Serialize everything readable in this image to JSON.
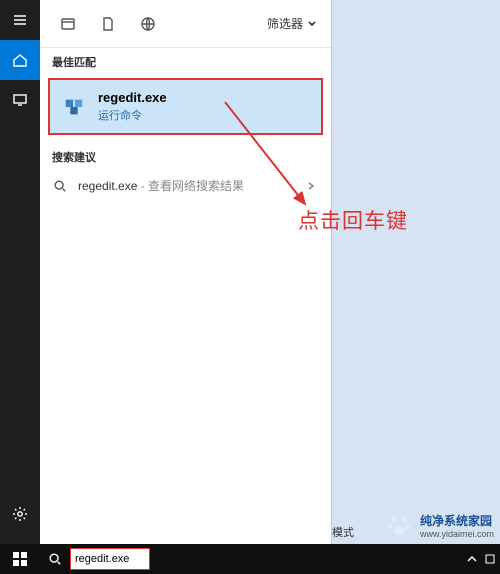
{
  "sidebar": {
    "items": [
      {
        "name": "menu"
      },
      {
        "name": "home"
      },
      {
        "name": "monitor"
      }
    ],
    "bottom": [
      {
        "name": "settings"
      },
      {
        "name": "user"
      }
    ]
  },
  "panel": {
    "filter_label": "筛选器",
    "best_match_label": "最佳匹配",
    "best_match": {
      "title": "regedit.exe",
      "subtitle": "运行命令"
    },
    "suggest_label": "搜索建议",
    "suggest": {
      "query": "regedit.exe",
      "hint": " - 查看网络搜索结果"
    }
  },
  "annotation": {
    "text": "点击回车键"
  },
  "desktop": {
    "mode_suffix": "模式"
  },
  "taskbar": {
    "search_value": "regedit.exe"
  },
  "watermark": {
    "brand": "纯净系统家园",
    "url": "www.yidaimei.com"
  }
}
